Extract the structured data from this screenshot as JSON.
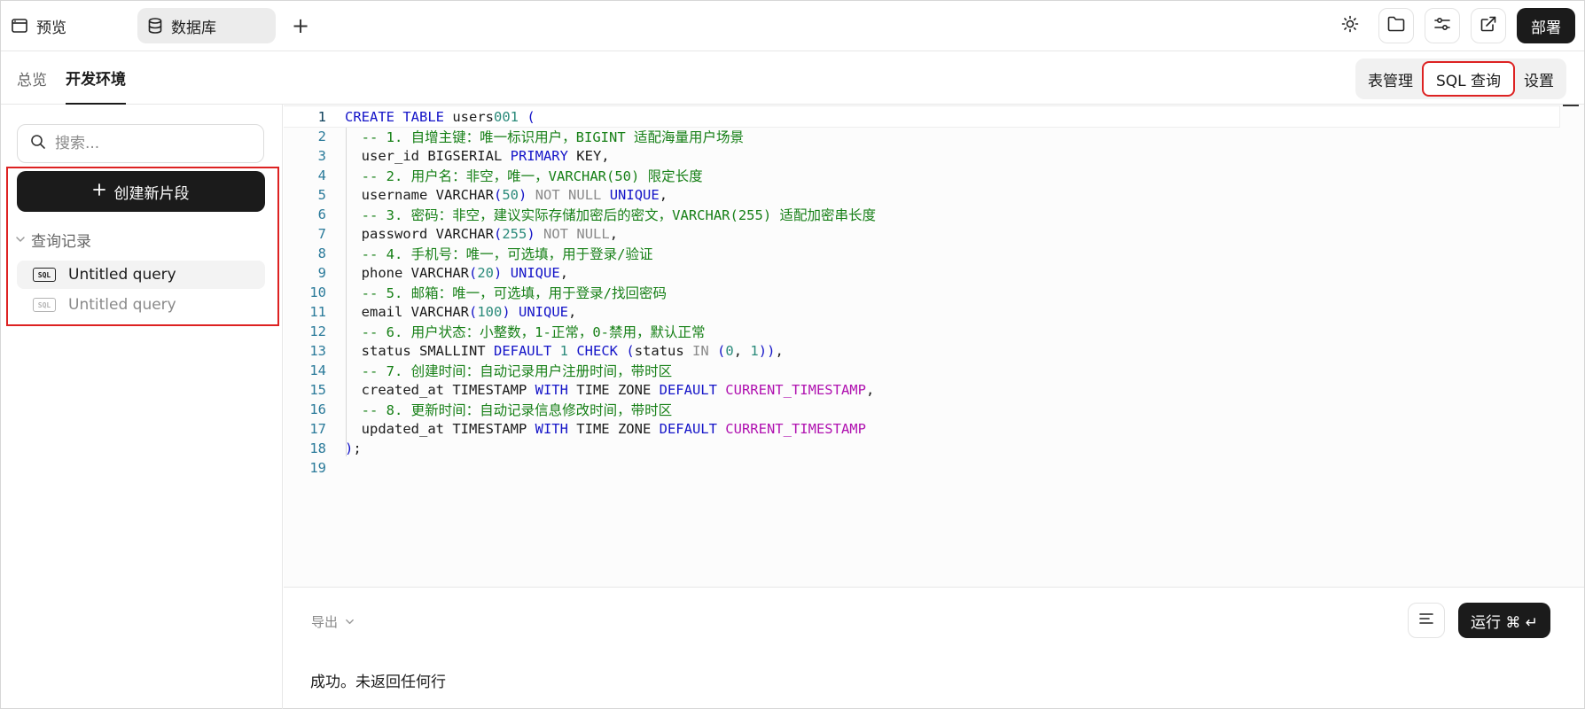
{
  "topbar": {
    "tabs": [
      {
        "label": "预览",
        "icon": "window-icon"
      },
      {
        "label": "数据库",
        "icon": "database-icon"
      }
    ],
    "add_tab": "+",
    "actions": [
      "sun-icon",
      "folder-icon",
      "sliders-icon",
      "external-link-icon"
    ],
    "deploy_label": "部署"
  },
  "subheader": {
    "tabs": [
      "总览",
      "开发环境"
    ],
    "active_tab": "开发环境",
    "right_tabs": [
      "表管理",
      "SQL 查询",
      "设置"
    ],
    "right_active": "SQL 查询"
  },
  "sidebar": {
    "search_placeholder": "搜索...",
    "create_label": "创建新片段",
    "history_label": "查询记录",
    "queries": [
      {
        "label": "Untitled query",
        "badge": "SQL"
      },
      {
        "label": "Untitled query",
        "badge": "SQL"
      }
    ]
  },
  "editor": {
    "line_numbers": [
      "1",
      "2",
      "3",
      "4",
      "5",
      "6",
      "7",
      "8",
      "9",
      "10",
      "11",
      "12",
      "13",
      "14",
      "15",
      "16",
      "17",
      "18",
      "19"
    ],
    "lines": [
      "CREATE TABLE users001 (",
      "  -- 1. 自增主键：唯一标识用户，BIGINT 适配海量用户场景",
      "  user_id BIGSERIAL PRIMARY KEY,",
      "  -- 2. 用户名：非空，唯一，VARCHAR(50) 限定长度",
      "  username VARCHAR(50) NOT NULL UNIQUE,",
      "  -- 3. 密码：非空，建议实际存储加密后的密文，VARCHAR(255) 适配加密串长度",
      "  password VARCHAR(255) NOT NULL,",
      "  -- 4. 手机号：唯一，可选填，用于登录/验证",
      "  phone VARCHAR(20) UNIQUE,",
      "  -- 5. 邮箱：唯一，可选填，用于登录/找回密码",
      "  email VARCHAR(100) UNIQUE,",
      "  -- 6. 用户状态：小整数，1-正常，0-禁用，默认正常",
      "  status SMALLINT DEFAULT 1 CHECK (status IN (0, 1)),",
      "  -- 7. 创建时间：自动记录用户注册时间，带时区",
      "  created_at TIMESTAMP WITH TIME ZONE DEFAULT CURRENT_TIMESTAMP,",
      "  -- 8. 更新时间：自动记录信息修改时间，带时区",
      "  updated_at TIMESTAMP WITH TIME ZONE DEFAULT CURRENT_TIMESTAMP",
      ");",
      ""
    ]
  },
  "bottom": {
    "export_label": "导出",
    "run_label": "运行 ⌘ ↵",
    "result_text": "成功。未返回任何行"
  },
  "colors": {
    "keyword": "#1414c8",
    "comment": "#178017",
    "number": "#2a8a7a",
    "function": "#b012b0",
    "highlight": "#dd2222",
    "primary": "#1b1b1b"
  }
}
